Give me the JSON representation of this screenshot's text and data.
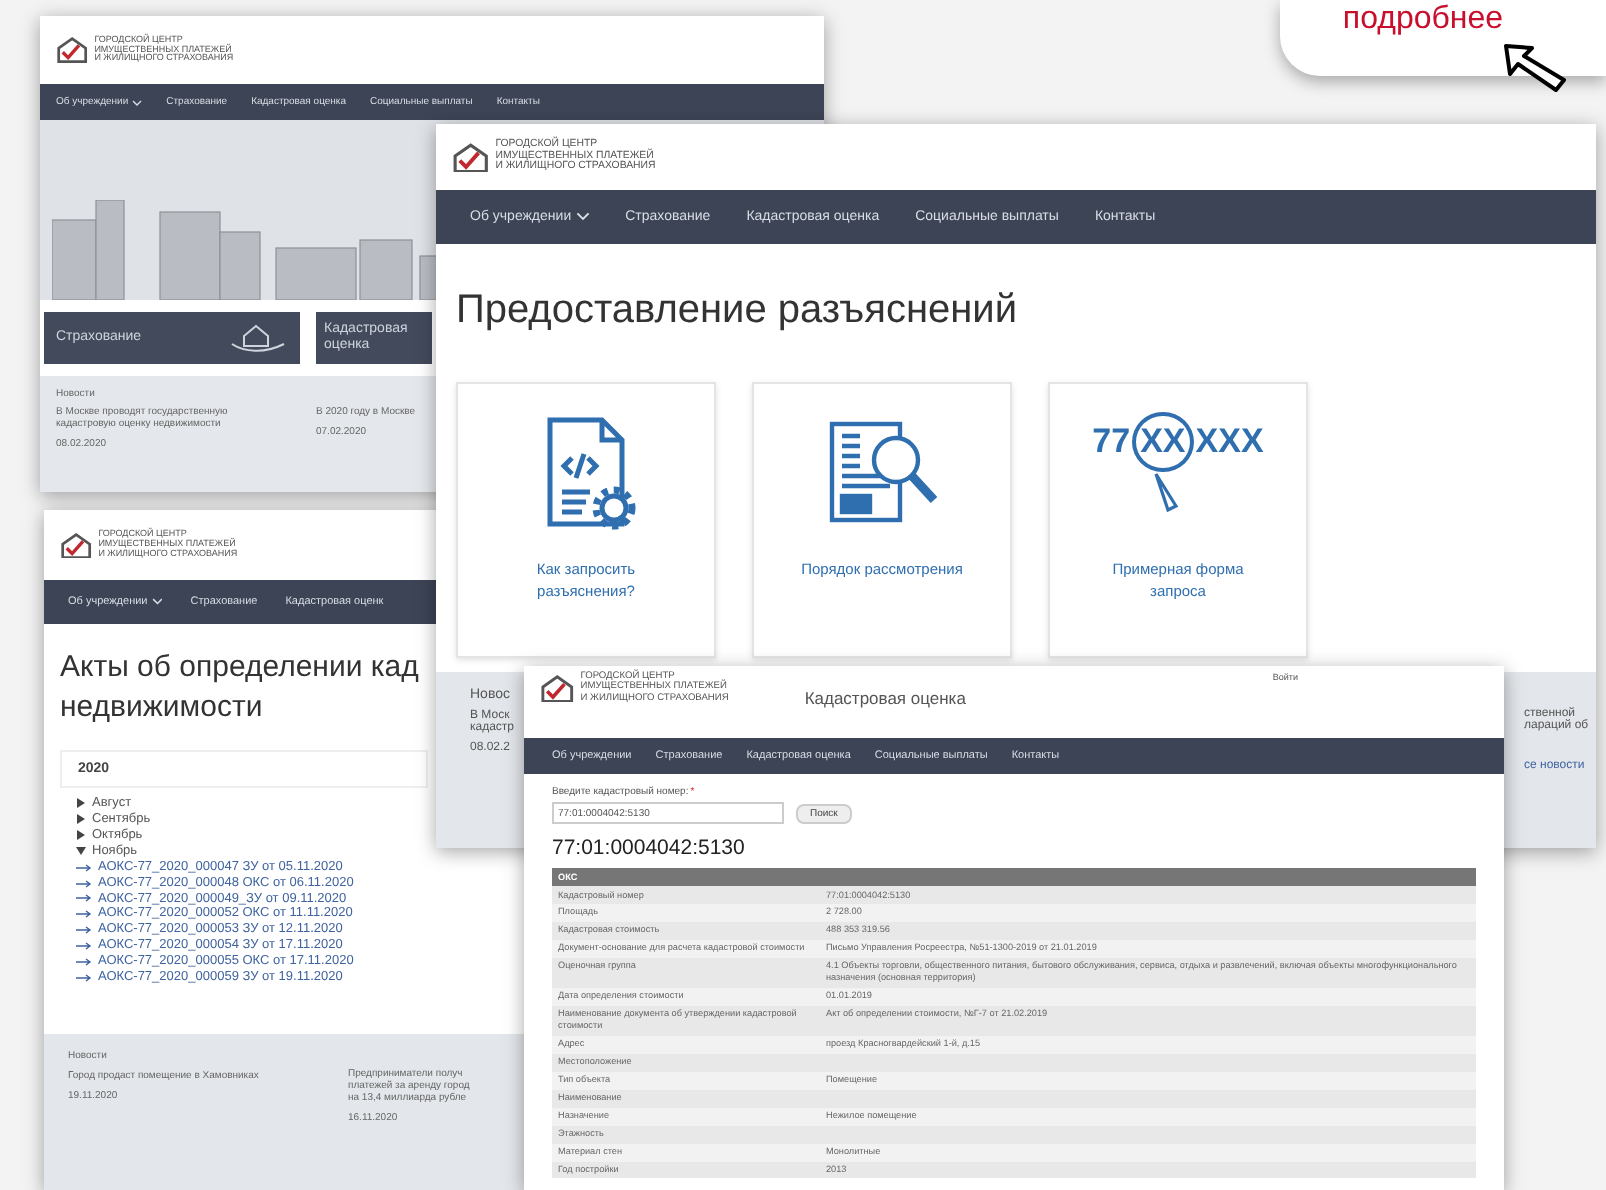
{
  "callout": {
    "text": "подробнее"
  },
  "windows": [
    {
      "kind": "home",
      "logo": "ГОРОДСКОЙ ЦЕНТР\nИМУЩЕСТВЕННЫХ ПЛАТЕЖЕЙ\nИ ЖИЛИЩНОГО СТРАХОВАНИЯ",
      "nav": [
        {
          "label": "Об учреждении",
          "has_menu": true
        },
        {
          "label": "Страхование",
          "has_menu": false
        },
        {
          "label": "Кадастровая оценка",
          "has_menu": false
        },
        {
          "label": "Социальные выплаты",
          "has_menu": false
        },
        {
          "label": "Контакты",
          "has_menu": false
        }
      ],
      "tiles": [
        {
          "kind": "insurance",
          "label": "Страхование"
        },
        {
          "kind": "cadastre",
          "label": "Кадастровая оценка"
        }
      ],
      "news": {
        "title": "Новости",
        "items": [
          {
            "text": "В Москве проводят государственную кадастровую оценку недвижимости",
            "date": "08.02.2020"
          },
          {
            "text": "В 2020 году в Москве",
            "date": "07.02.2020"
          }
        ]
      }
    },
    {
      "kind": "acts",
      "logo": "ГОРОДСКОЙ ЦЕНТР\nИМУЩЕСТВЕННЫХ ПЛАТЕЖЕЙ\nИ ЖИЛИЩНОГО СТРАХОВАНИЯ",
      "nav": [
        {
          "label": "Об учреждении",
          "has_menu": true
        },
        {
          "label": "Страхование",
          "has_menu": false
        },
        {
          "label": "Кадастровая оценк",
          "has_menu": false
        }
      ],
      "title_lines": [
        "Акты об определении кад",
        "недвижимости"
      ],
      "year": "2020",
      "months": [
        {
          "label": "Август",
          "expanded": false
        },
        {
          "label": "Сентябрь",
          "expanded": false
        },
        {
          "label": "Октябрь",
          "expanded": false
        },
        {
          "label": "Ноябрь",
          "expanded": true,
          "children": [
            "АОКС-77_2020_000047 ЗУ от 05.11.2020",
            "АОКС-77_2020_000048 ОКС от 06.11.2020",
            "АОКС-77_2020_000049_ЗУ от 09.11.2020",
            "АОКС-77_2020_000052 ОКС от 11.11.2020",
            "АОКС-77_2020_000053 ЗУ от 12.11.2020",
            "АОКС-77_2020_000054 ЗУ от 17.11.2020",
            "АОКС-77_2020_000055 ОКС от 17.11.2020",
            "АОКС-77_2020_000059 ЗУ от 19.11.2020"
          ]
        }
      ],
      "news": {
        "title": "Новости",
        "items": [
          {
            "lines": [
              "Город продаст помещение в Хамовниках"
            ],
            "date": "19.11.2020"
          },
          {
            "lines": [
              "Предприниматели получ",
              "платежей за аренду город",
              "на 13,4 миллиарда рубле"
            ],
            "date": "16.11.2020"
          }
        ]
      }
    },
    {
      "kind": "explain",
      "logo": "ГОРОДСКОЙ ЦЕНТР\nИМУЩЕСТВЕННЫХ ПЛАТЕЖЕЙ\nИ ЖИЛИЩНОГО СТРАХОВАНИЯ",
      "nav": [
        {
          "label": "Об учреждении",
          "has_menu": true
        },
        {
          "label": "Страхование",
          "has_menu": false
        },
        {
          "label": "Кадастровая оценка",
          "has_menu": false
        },
        {
          "label": "Социальные выплаты",
          "has_menu": false
        },
        {
          "label": "Контакты",
          "has_menu": false
        }
      ],
      "title": "Предоставление разъяснений",
      "cards": [
        {
          "kind": "document",
          "label": "Как запросить разъяснения?"
        },
        {
          "kind": "newspaper",
          "label": "Порядок рассмотрения"
        },
        {
          "kind": "sample",
          "label": "Примерная форма запроса",
          "sample": [
            "77",
            "XX",
            "XXX"
          ]
        }
      ],
      "news": {
        "title": "Новос",
        "left_lines": [
          "В Моск",
          "кадастр"
        ],
        "left_date": "08.02.2",
        "right_lines": [
          "ственной",
          "лараций об"
        ],
        "more_link": "се новости"
      }
    },
    {
      "kind": "cadastral",
      "logo": "ГОРОДСКОЙ ЦЕНТР\nИМУЩЕСТВЕННЫХ ПЛАТЕЖЕЙ\nИ ЖИЛИЩНОГО СТРАХОВАНИЯ",
      "page_title": "Кадастровая оценка",
      "login": "Войти",
      "nav": [
        {
          "label": "Об учреждении",
          "has_menu": false
        },
        {
          "label": "Страхование",
          "has_menu": false
        },
        {
          "label": "Кадастровая оценка",
          "has_menu": false
        },
        {
          "label": "Социальные выплаты",
          "has_menu": false
        },
        {
          "label": "Контакты",
          "has_menu": false
        }
      ],
      "search": {
        "label": "Введите кадастровый номер:",
        "required_mark": "*",
        "value": "77:01:0004042:5130",
        "button": "Поиск"
      },
      "heading": "77:01:0004042:5130",
      "table": {
        "caption": "ОКС",
        "rows": [
          {
            "label": "Кадастровый номер",
            "value": "77:01:0004042:5130"
          },
          {
            "label": "Площадь",
            "value": "2 728.00"
          },
          {
            "label": "Кадастровая стоимость",
            "value": "488 353 319.56"
          },
          {
            "label": "Документ-основание для расчета кадастровой стоимости",
            "value": "Письмо Управления Росреестра, №51-1300-2019 от 21.01.2019"
          },
          {
            "label": "Оценочная группа",
            "value": "4.1 Объекты торговли, общественного питания, бытового обслуживания, сервиса, отдыха и развлечений, включая объекты многофункционального назначения (основная территория)"
          },
          {
            "label": "Дата определения стоимости",
            "value": "01.01.2019"
          },
          {
            "label": "Наименование документа об утверждении кадастровой стоимости",
            "value": "Акт об определении стоимости, №Г-7 от 21.02.2019"
          },
          {
            "label": "Адрес",
            "value": "проезд Красногвардейский 1-й, д.15"
          },
          {
            "label": "Местоположение"
          },
          {
            "label": "Тип объекта",
            "value": "Помещение"
          },
          {
            "label": "Наименование"
          },
          {
            "label": "Назначение",
            "value": "Нежилое помещение"
          },
          {
            "label": "Этажность"
          },
          {
            "label": "Материал стен",
            "value": "Монолитные"
          },
          {
            "label": "Год постройки",
            "value": "2013"
          }
        ]
      }
    }
  ]
}
